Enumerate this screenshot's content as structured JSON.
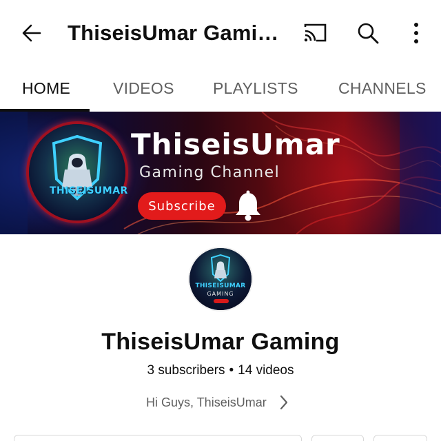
{
  "header": {
    "title": "ThiseisUmar Gamin…",
    "back_icon": "arrow-left-icon",
    "cast_icon": "cast-icon",
    "search_icon": "search-icon",
    "more_icon": "more-vert-icon"
  },
  "tabs": [
    {
      "label": "HOME",
      "active": true
    },
    {
      "label": "VIDEOS",
      "active": false
    },
    {
      "label": "PLAYLISTS",
      "active": false
    },
    {
      "label": "CHANNELS",
      "active": false
    }
  ],
  "banner": {
    "title": "ThiseisUmar",
    "subtitle": "Gaming Channel",
    "subscribe_label": "Subscribe",
    "logo_text": "THISEISUMAR",
    "bell_icon": "bell-icon"
  },
  "channel": {
    "avatar_text": "THISEISUMAR",
    "avatar_sub": "GAMING",
    "name": "ThiseisUmar Gaming",
    "subscribers": "3 subscribers",
    "separator": "•",
    "videos": "14 videos",
    "description": "Hi Guys, ThiseisUmar"
  },
  "colors": {
    "accent_red": "#e21b1b",
    "text_primary": "#0f0f0f",
    "text_secondary": "#606060"
  }
}
